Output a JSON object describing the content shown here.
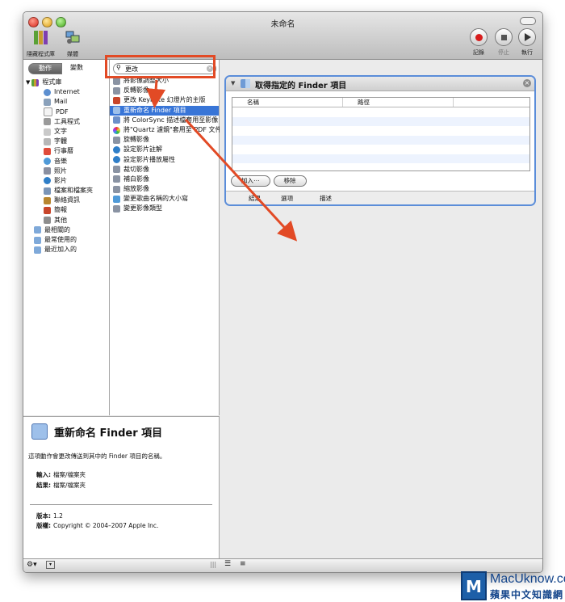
{
  "window": {
    "title": "未命名"
  },
  "toolbar": {
    "hide_library": "隱藏程式庫",
    "media": "媒體",
    "record": "記錄",
    "stop": "停止",
    "run": "執行"
  },
  "library": {
    "tab_actions": "動作",
    "tab_variables": "變數",
    "root": "程式庫",
    "items": [
      "Internet",
      "Mail",
      "PDF",
      "工具程式",
      "文字",
      "字體",
      "行事曆",
      "音樂",
      "照片",
      "影片",
      "檔案和檔案夾",
      "聯絡資訊",
      "簡報",
      "其他"
    ],
    "groups": [
      "最相關的",
      "最常使用的",
      "最近加入的"
    ]
  },
  "search": {
    "value": "更改"
  },
  "actions": {
    "items": [
      "將影像調整大小",
      "反轉影像",
      "更改 Keynote 幻燈片的主版",
      "重新命名 Finder 項目",
      "將 ColorSync 描述檔套用至影像",
      "將\"Quartz 濾鏡\"套用至 PDF 文件",
      "旋轉影像",
      "設定影片註解",
      "設定影片播放屬性",
      "裁切影像",
      "補白影像",
      "縮放影像",
      "變更歌曲名稱的大小寫",
      "變更影像類型"
    ],
    "selected_index": 3
  },
  "detail": {
    "title": "重新命名 Finder 項目",
    "description": "這項動作會更改傳送到其中的 Finder 項目的名稱。",
    "input_label": "輸入:",
    "input_value": "檔案/檔案夾",
    "result_label": "結果:",
    "result_value": "檔案/檔案夾",
    "version_label": "版本:",
    "version_value": "1.2",
    "copyright_label": "版權:",
    "copyright_value": "Copyright © 2004–2007 Apple Inc."
  },
  "workflow": {
    "action_title": "取得指定的 Finder 項目",
    "col_name": "名稱",
    "col_path": "路徑",
    "add_button": "加入⋯",
    "remove_button": "移除",
    "tab_results": "結果",
    "tab_options": "選項",
    "tab_description": "描述"
  },
  "watermark": {
    "line1": "MacUknow.com",
    "line2": "蘋果中文知識網"
  },
  "colors": {
    "accent": "#3875d7",
    "annotation": "#e24a25",
    "panel_border": "#5b8dd9"
  }
}
